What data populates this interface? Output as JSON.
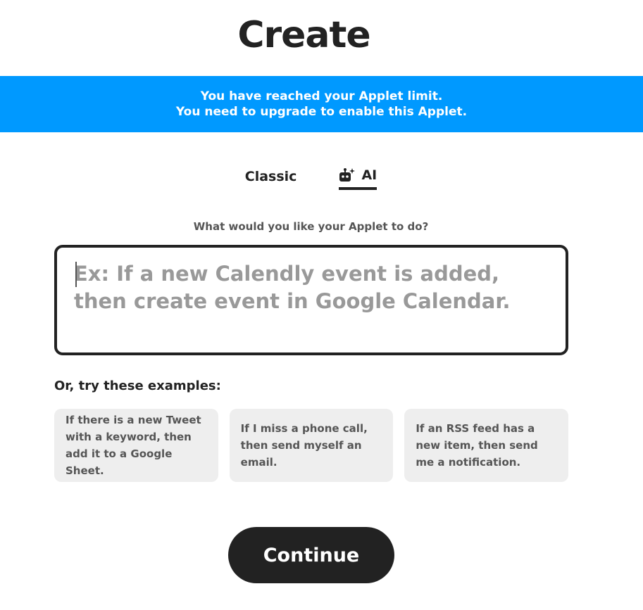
{
  "header": {
    "title": "Create"
  },
  "banner": {
    "line1": "You have reached your Applet limit.",
    "line2": "You need to upgrade to enable this Applet."
  },
  "tabs": [
    {
      "label": "Classic",
      "active": false
    },
    {
      "label": "AI",
      "active": true,
      "icon": "robot-sparkle-icon"
    }
  ],
  "prompt": {
    "label": "What would you like your Applet to do?",
    "value": "",
    "placeholder": "Ex: If a new Calendly event is added, then create event in Google Calendar."
  },
  "examples": {
    "heading": "Or, try these examples:",
    "items": [
      "If there is a new Tweet with a keyword, then add it to a Google Sheet.",
      "If I miss a phone call, then send myself an email.",
      "If an RSS feed has a new item, then send me a notification."
    ]
  },
  "continue_label": "Continue",
  "colors": {
    "banner": "#0099ff",
    "text_dark": "#222222",
    "card_bg": "#eeeeee",
    "placeholder": "#999999"
  }
}
